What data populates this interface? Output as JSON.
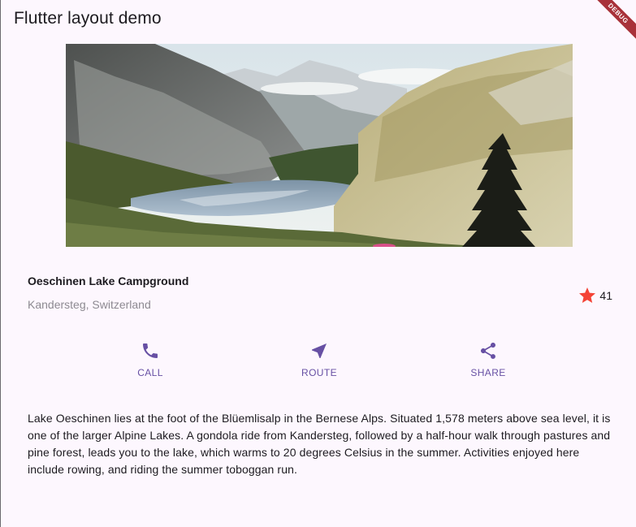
{
  "appbar": {
    "title": "Flutter layout demo",
    "debug_label": "DEBUG"
  },
  "place": {
    "name": "Oeschinen Lake Campground",
    "location": "Kandersteg, Switzerland",
    "rating_count": "41"
  },
  "actions": [
    {
      "label": "CALL",
      "icon": "phone-icon"
    },
    {
      "label": "ROUTE",
      "icon": "navigation-icon"
    },
    {
      "label": "SHARE",
      "icon": "share-icon"
    }
  ],
  "description": "Lake Oeschinen lies at the foot of the Blüemlisalp in the Bernese Alps. Situated 1,578 meters above sea level, it is one of the larger Alpine Lakes. A gondola ride from Kandersteg, followed by a half-hour walk through pastures and pine forest, leads you to the lake, which warms to 20 degrees Celsius in the summer. Activities enjoyed here include rowing, and riding the summer toboggan run.",
  "colors": {
    "primary": "#6750a4",
    "star": "#f44336",
    "background": "#fdf7fe",
    "debug_banner": "#a8323a"
  }
}
